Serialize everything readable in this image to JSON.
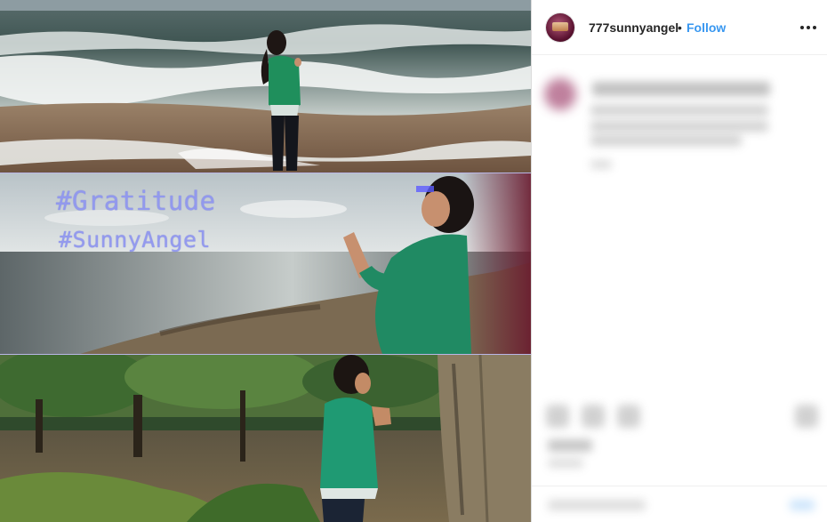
{
  "post": {
    "username": "777sunnyangel",
    "separator": "•",
    "follow_label": "Follow",
    "more_icon": "more-options-icon"
  },
  "photo": {
    "hashtags": [
      "#Gratitude",
      "#SunnyAngel"
    ]
  },
  "colors": {
    "link_blue": "#3897f0",
    "text_dark": "#262626",
    "hashtag_purple": "#8e95f0",
    "border": "#dbdbdb"
  }
}
